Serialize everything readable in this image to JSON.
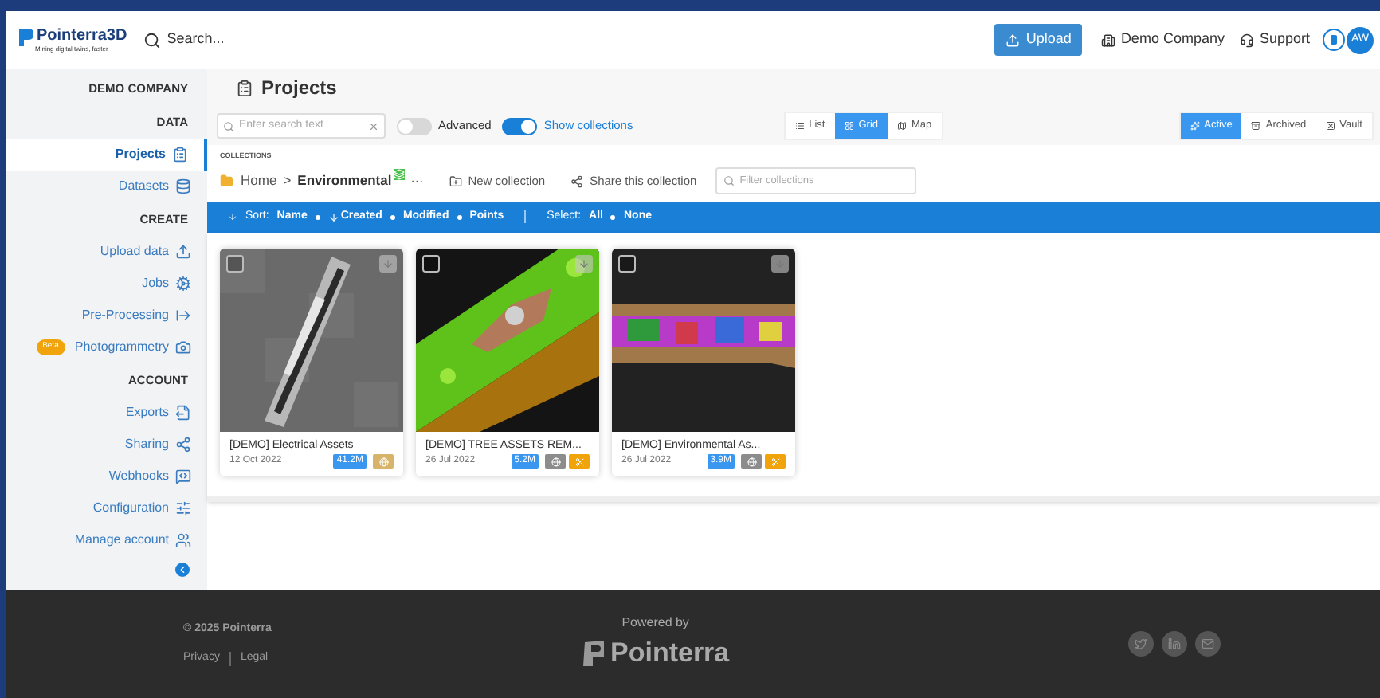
{
  "header": {
    "logo": "Pointerra3D",
    "tagline": "Mining digital twins, faster",
    "search": "Search...",
    "upload": "Upload",
    "company": "Demo Company",
    "support": "Support",
    "avatar": "AW"
  },
  "sidebar": {
    "company": "DEMO COMPANY",
    "sections": [
      {
        "heading": "DATA",
        "items": [
          {
            "label": "Projects",
            "selected": true
          },
          {
            "label": "Datasets",
            "selected": false
          }
        ]
      },
      {
        "heading": "CREATE",
        "items": [
          {
            "label": "Upload data",
            "selected": false
          },
          {
            "label": "Jobs",
            "selected": false
          },
          {
            "label": "Pre-Processing",
            "selected": false
          },
          {
            "label": "Photogrammetry",
            "selected": false,
            "badge": "Beta"
          }
        ]
      },
      {
        "heading": "ACCOUNT",
        "items": [
          {
            "label": "Exports",
            "selected": false
          },
          {
            "label": "Sharing",
            "selected": false
          },
          {
            "label": "Webhooks",
            "selected": false
          },
          {
            "label": "Configuration",
            "selected": false
          },
          {
            "label": "Manage account",
            "selected": false
          }
        ]
      }
    ]
  },
  "page": {
    "title": "Projects",
    "search_placeholder": "Enter search text",
    "toggles": [
      {
        "label": "Advanced",
        "on": false
      },
      {
        "label": "Show collections",
        "on": true
      }
    ],
    "views": [
      {
        "label": "List",
        "selected": false
      },
      {
        "label": "Grid",
        "selected": true
      },
      {
        "label": "Map",
        "selected": false
      }
    ],
    "states": [
      {
        "label": "Active",
        "selected": true
      },
      {
        "label": "Archived",
        "selected": false
      },
      {
        "label": "Vault",
        "selected": false
      }
    ],
    "collections_label": "COLLECTIONS",
    "breadcrumb": {
      "home": "Home",
      "separator": ">",
      "current": "Environmental",
      "more": "···"
    },
    "new_collection": "New collection",
    "share_collection": "Share this collection",
    "filter_placeholder": "Filter collections",
    "sort_label": "Sort:",
    "sort_options": [
      {
        "label": "Name",
        "sorted": false
      },
      {
        "label": "Created",
        "sorted": true
      },
      {
        "label": "Modified",
        "sorted": false
      },
      {
        "label": "Points",
        "sorted": false
      }
    ],
    "select_label": "Select:",
    "select_options": [
      "All",
      "None"
    ],
    "cards": [
      {
        "kind": "picture",
        "checked": false,
        "name": "[DEMO] Electrical Assets",
        "date": "12 Oct 2022",
        "points": "41.2M",
        "badges": [
          {
            "kind": "globe",
            "color": "#d8b46a"
          }
        ]
      },
      {
        "kind": "picture",
        "checked": false,
        "name": "[DEMO] TREE ASSETS REM...",
        "date": "26 Jul 2022",
        "points": "5.2M",
        "badges": [
          {
            "kind": "globe",
            "color": "#8c8c8c"
          },
          {
            "kind": "scissors",
            "color": "#f0a30a"
          }
        ]
      },
      {
        "kind": "picture",
        "checked": false,
        "name": "[DEMO] Environmental As...",
        "date": "26 Jul 2022",
        "points": "3.9M",
        "badges": [
          {
            "kind": "globe",
            "color": "#8c8c8c"
          },
          {
            "kind": "scissors",
            "color": "#f0a30a"
          }
        ]
      }
    ]
  },
  "footer": {
    "copyright": "© 2025 Pointerra",
    "links": [
      "Privacy",
      "Legal"
    ],
    "powered_by": "Powered by",
    "brand": "Pointerra"
  }
}
